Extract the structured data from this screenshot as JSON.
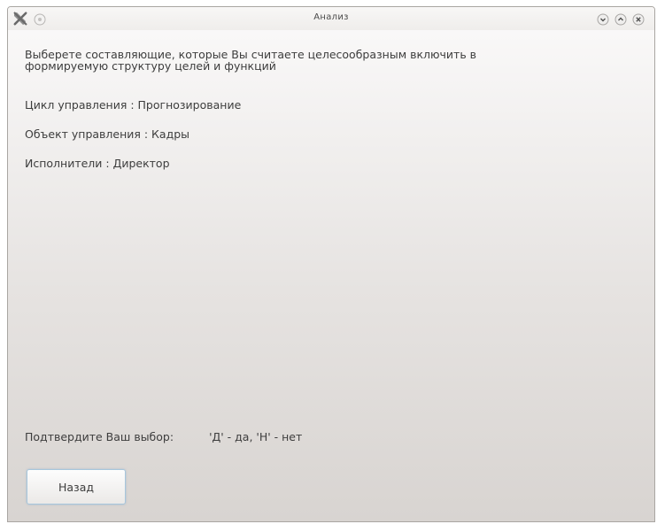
{
  "window": {
    "title": "Анализ",
    "app_icon": "tools-icon",
    "pin_icon": "pin-icon",
    "controls": [
      "minimize-icon",
      "maximize-icon",
      "close-icon"
    ]
  },
  "content": {
    "prompt": "Выберете составляющие, которые Вы считаете целесообразным включить в формируемую структуру целей и функций",
    "cycle_line": "Цикл управления : Прогнозирование",
    "object_line": "Объект управления : Кадры",
    "executors_line": "Исполнители : Директор",
    "confirm_label": "Подтвердите Ваш выбор:",
    "confirm_hint": "'Д' - да, 'Н' - нет",
    "back_button_label": "Назад"
  },
  "colors": {
    "text": "#3d3d3d",
    "button_border": "#a7c6dc",
    "window_bg_top": "#fbfafa",
    "window_bg_bottom": "#d8d4d1"
  }
}
